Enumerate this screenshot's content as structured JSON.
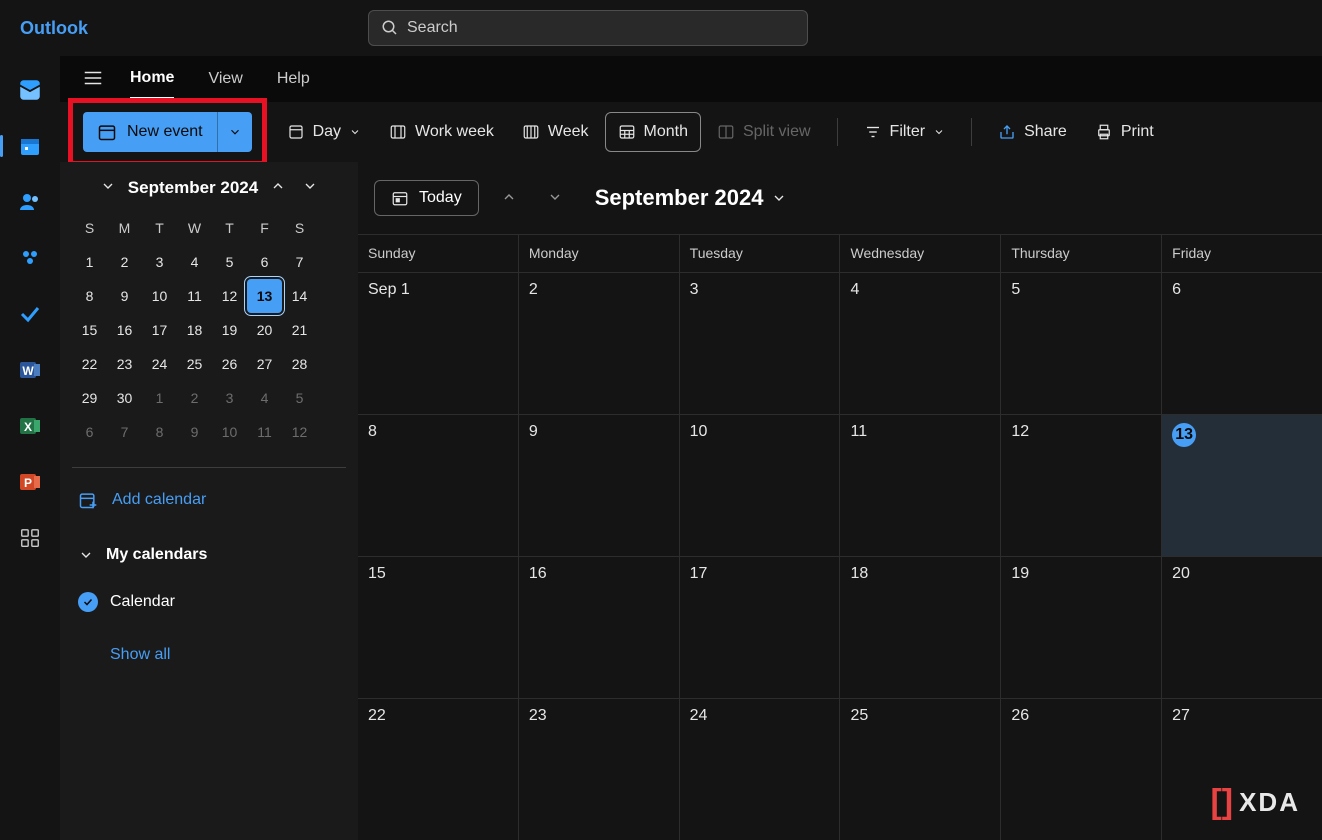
{
  "app": {
    "title": "Outlook"
  },
  "search": {
    "placeholder": "Search"
  },
  "menu": {
    "home": "Home",
    "view": "View",
    "help": "Help"
  },
  "toolbar": {
    "new_event": "New event",
    "day": "Day",
    "work_week": "Work week",
    "week": "Week",
    "month": "Month",
    "split_view": "Split view",
    "filter": "Filter",
    "share": "Share",
    "print": "Print"
  },
  "mini_cal": {
    "title": "September 2024",
    "dow": [
      "S",
      "M",
      "T",
      "W",
      "T",
      "F",
      "S"
    ],
    "weeks": [
      [
        {
          "n": "1"
        },
        {
          "n": "2"
        },
        {
          "n": "3"
        },
        {
          "n": "4"
        },
        {
          "n": "5"
        },
        {
          "n": "6"
        },
        {
          "n": "7"
        }
      ],
      [
        {
          "n": "8"
        },
        {
          "n": "9"
        },
        {
          "n": "10"
        },
        {
          "n": "11"
        },
        {
          "n": "12"
        },
        {
          "n": "13",
          "today": true
        },
        {
          "n": "14"
        }
      ],
      [
        {
          "n": "15"
        },
        {
          "n": "16"
        },
        {
          "n": "17"
        },
        {
          "n": "18"
        },
        {
          "n": "19"
        },
        {
          "n": "20"
        },
        {
          "n": "21"
        }
      ],
      [
        {
          "n": "22"
        },
        {
          "n": "23"
        },
        {
          "n": "24"
        },
        {
          "n": "25"
        },
        {
          "n": "26"
        },
        {
          "n": "27"
        },
        {
          "n": "28"
        }
      ],
      [
        {
          "n": "29"
        },
        {
          "n": "30"
        },
        {
          "n": "1",
          "dim": true
        },
        {
          "n": "2",
          "dim": true
        },
        {
          "n": "3",
          "dim": true
        },
        {
          "n": "4",
          "dim": true
        },
        {
          "n": "5",
          "dim": true
        }
      ],
      [
        {
          "n": "6",
          "dim": true
        },
        {
          "n": "7",
          "dim": true
        },
        {
          "n": "8",
          "dim": true
        },
        {
          "n": "9",
          "dim": true
        },
        {
          "n": "10",
          "dim": true
        },
        {
          "n": "11",
          "dim": true
        },
        {
          "n": "12",
          "dim": true
        }
      ]
    ]
  },
  "sidebar": {
    "add_calendar": "Add calendar",
    "my_calendars": "My calendars",
    "calendar_entry": "Calendar",
    "show_all": "Show all"
  },
  "controls": {
    "today": "Today",
    "month_title": "September 2024"
  },
  "big_cal": {
    "dow": [
      "Sunday",
      "Monday",
      "Tuesday",
      "Wednesday",
      "Thursday",
      "Friday"
    ],
    "weeks": [
      [
        {
          "n": "Sep 1"
        },
        {
          "n": "2"
        },
        {
          "n": "3"
        },
        {
          "n": "4"
        },
        {
          "n": "5"
        },
        {
          "n": "6"
        }
      ],
      [
        {
          "n": "8"
        },
        {
          "n": "9"
        },
        {
          "n": "10"
        },
        {
          "n": "11"
        },
        {
          "n": "12"
        },
        {
          "n": "13",
          "today": true
        }
      ],
      [
        {
          "n": "15"
        },
        {
          "n": "16"
        },
        {
          "n": "17"
        },
        {
          "n": "18"
        },
        {
          "n": "19"
        },
        {
          "n": "20"
        }
      ],
      [
        {
          "n": "22"
        },
        {
          "n": "23"
        },
        {
          "n": "24"
        },
        {
          "n": "25"
        },
        {
          "n": "26"
        },
        {
          "n": "27"
        }
      ]
    ]
  },
  "watermark": {
    "text": "XDA"
  }
}
